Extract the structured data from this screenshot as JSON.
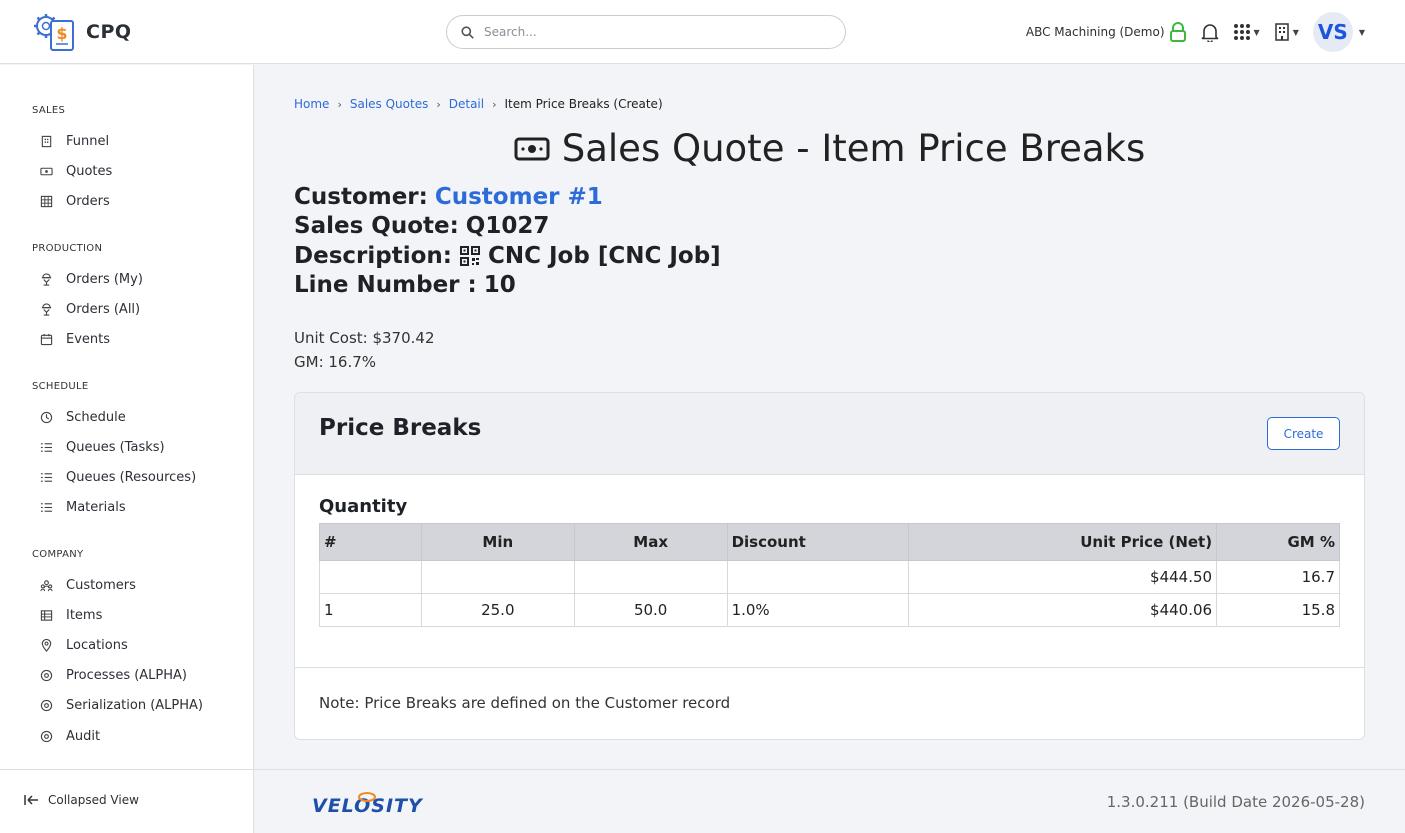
{
  "app": {
    "name": "CPQ"
  },
  "search": {
    "placeholder": "Search..."
  },
  "header": {
    "tenant": "ABC Machining (Demo)",
    "avatar_initials": "VS"
  },
  "sidebar": {
    "sections": [
      {
        "title": "SALES",
        "items": [
          {
            "label": "Funnel",
            "icon": "building-icon"
          },
          {
            "label": "Quotes",
            "icon": "money-icon"
          },
          {
            "label": "Orders",
            "icon": "grid-icon"
          }
        ]
      },
      {
        "title": "PRODUCTION",
        "items": [
          {
            "label": "Orders (My)",
            "icon": "worker-icon"
          },
          {
            "label": "Orders (All)",
            "icon": "worker-icon"
          },
          {
            "label": "Events",
            "icon": "calendar-icon"
          }
        ]
      },
      {
        "title": "SCHEDULE",
        "items": [
          {
            "label": "Schedule",
            "icon": "clock-icon"
          },
          {
            "label": "Queues (Tasks)",
            "icon": "list-icon"
          },
          {
            "label": "Queues (Resources)",
            "icon": "list-icon"
          },
          {
            "label": "Materials",
            "icon": "list-icon"
          }
        ]
      },
      {
        "title": "COMPANY",
        "items": [
          {
            "label": "Customers",
            "icon": "people-icon"
          },
          {
            "label": "Items",
            "icon": "items-icon"
          },
          {
            "label": "Locations",
            "icon": "location-icon"
          },
          {
            "label": "Processes (ALPHA)",
            "icon": "gear-badge-icon"
          },
          {
            "label": "Serialization (ALPHA)",
            "icon": "gear-badge-icon"
          },
          {
            "label": "Audit",
            "icon": "gear-badge-icon"
          }
        ]
      }
    ],
    "collapse_label": "Collapsed View"
  },
  "breadcrumb": {
    "home": "Home",
    "quotes": "Sales Quotes",
    "detail": "Detail",
    "current": "Item Price Breaks (Create)"
  },
  "page": {
    "title": "Sales Quote - Item Price Breaks",
    "customer_label": "Customer:",
    "customer_value": "Customer #1",
    "quote_label": "Sales Quote:",
    "quote_value": "Q1027",
    "description_label": "Description:",
    "description_value": "CNC Job [CNC Job]",
    "line_label": "Line Number :",
    "line_value": "10",
    "unit_cost": "Unit Cost: $370.42",
    "gm": "GM: 16.7%"
  },
  "price_breaks": {
    "title": "Price Breaks",
    "create_label": "Create",
    "quantity_label": "Quantity",
    "columns": [
      "#",
      "Min",
      "Max",
      "Discount",
      "Unit Price (Net)",
      "GM %"
    ],
    "rows": [
      [
        "",
        "",
        "",
        "",
        "$444.50",
        "16.7"
      ],
      [
        "1",
        "25.0",
        "50.0",
        "1.0%",
        "$440.06",
        "15.8"
      ]
    ],
    "note": "Note: Price Breaks are defined on the Customer record"
  },
  "footer": {
    "brand": "VELOSITY",
    "version": "1.3.0.211 (Build Date 2026-05-28)"
  },
  "colors": {
    "accent": "#2d6bd9",
    "lock": "#3db83d",
    "logo_orange": "#f08a24"
  }
}
